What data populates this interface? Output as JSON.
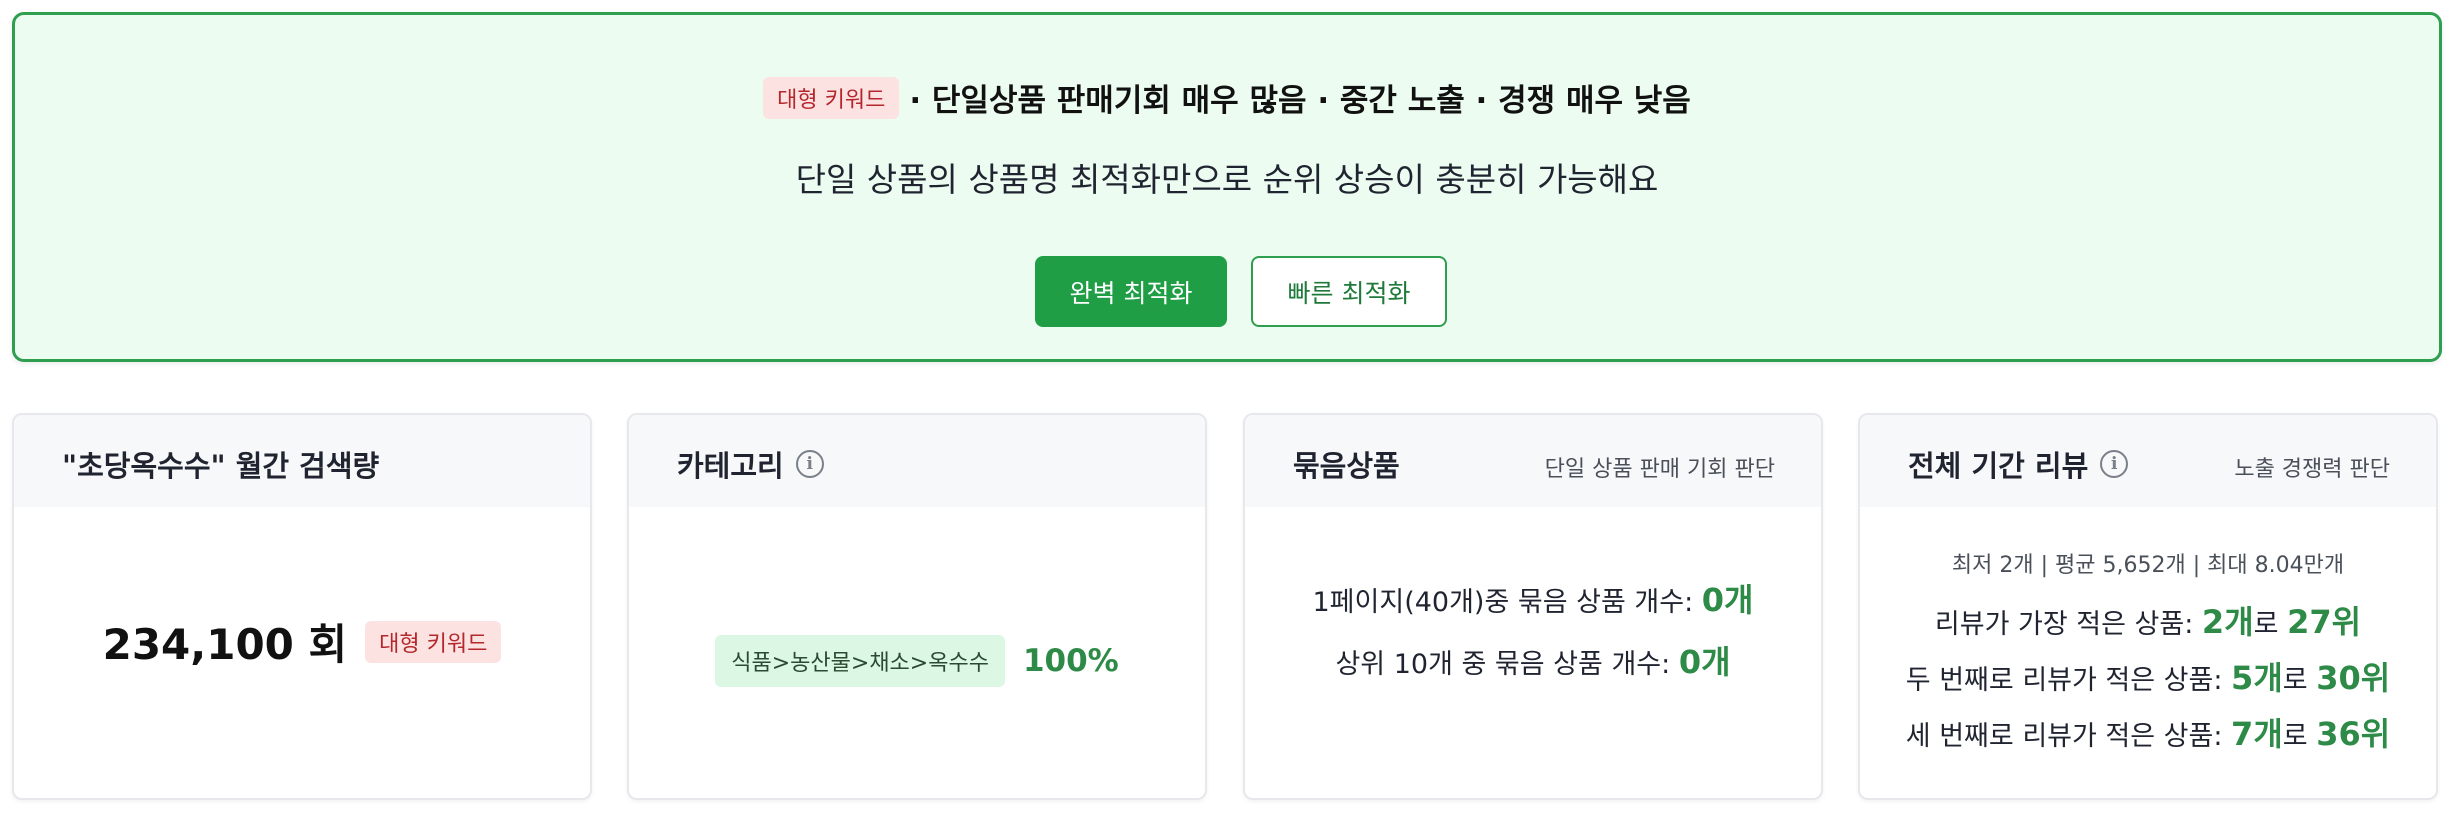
{
  "banner": {
    "badge": "대형 키워드",
    "headline": "· 단일상품 판매기회 매우 많음 · 중간 노출 · 경쟁 매우 낮음",
    "description": "단일 상품의 상품명 최적화만으로 순위 상승이 충분히 가능해요",
    "primary_button": "완벽 최적화",
    "secondary_button": "빠른 최적화"
  },
  "search_card": {
    "title": "\"초당옥수수\" 월간 검색량",
    "count": "234,100 회",
    "badge": "대형 키워드"
  },
  "category_card": {
    "title": "카테고리",
    "path": "식품>농산물>채소>옥수수",
    "percent": "100%"
  },
  "bundle_card": {
    "title": "묶음상품",
    "subtitle": "단일 상품 판매 기회 판단",
    "line1_label": "1페이지(40개)중 묶음 상품 개수: ",
    "line1_value": "0개",
    "line2_label": "상위 10개 중 묶음 상품 개수: ",
    "line2_value": "0개"
  },
  "review_card": {
    "title": "전체 기간 리뷰",
    "subtitle": "노출 경쟁력 판단",
    "summary": "최저 2개 | 평균 5,652개 | 최대 8.04만개",
    "rows": [
      {
        "label": "리뷰가 가장 적은 상품: ",
        "count": "2개",
        "mid": "로 ",
        "rank": "27위"
      },
      {
        "label": "두 번째로 리뷰가 적은 상품: ",
        "count": "5개",
        "mid": "로 ",
        "rank": "30위"
      },
      {
        "label": "세 번째로 리뷰가 적은 상품: ",
        "count": "7개",
        "mid": "로 ",
        "rank": "36위"
      }
    ]
  },
  "icons": {
    "info": "info-icon"
  },
  "colors": {
    "accent_green": "#1f9e45",
    "badge_red_bg": "#fde2e2",
    "badge_red_text": "#b4282d"
  }
}
